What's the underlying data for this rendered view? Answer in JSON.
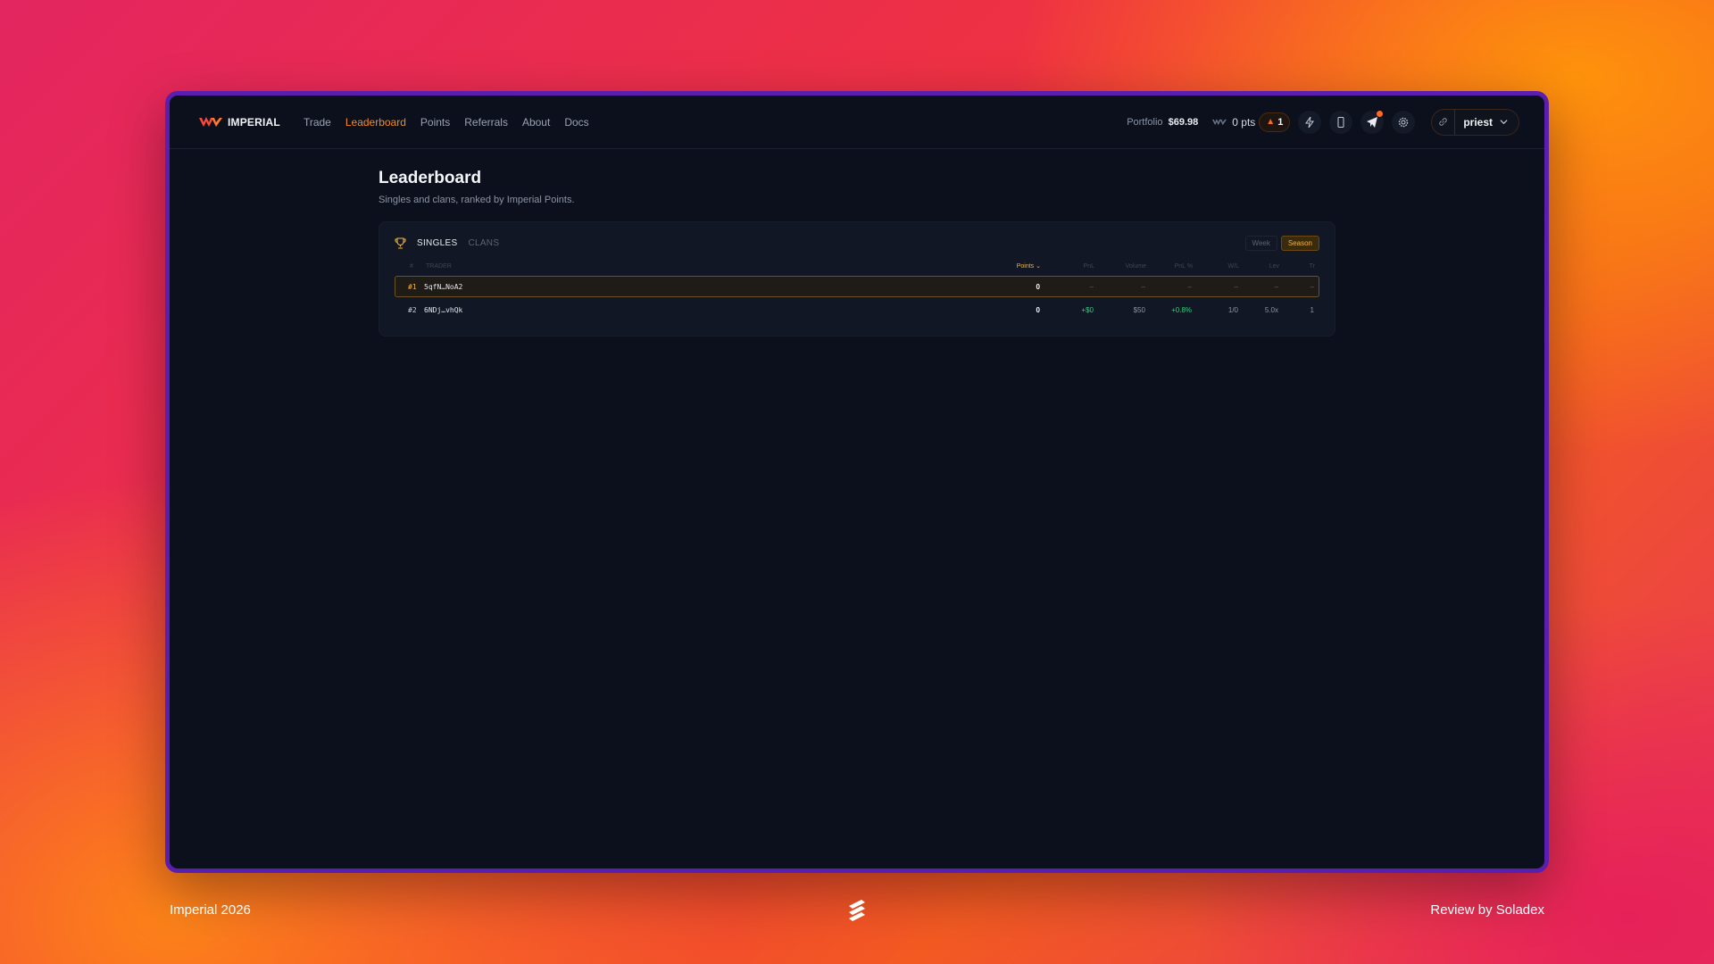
{
  "app": {
    "brand": "IMPERIAL",
    "nav": [
      {
        "label": "Trade",
        "active": false
      },
      {
        "label": "Leaderboard",
        "active": true
      },
      {
        "label": "Points",
        "active": false
      },
      {
        "label": "Referrals",
        "active": false
      },
      {
        "label": "About",
        "active": false
      },
      {
        "label": "Docs",
        "active": false
      }
    ],
    "portfolio_label": "Portfolio",
    "portfolio_value": "$69.98",
    "points": "0 pts",
    "streak": "1",
    "icons": [
      "bolt-icon",
      "phone-icon",
      "send-icon",
      "gear-icon"
    ],
    "user": "priest",
    "accent": "#f58a1f"
  },
  "page": {
    "title": "Leaderboard",
    "subtitle": "Singles and clans, ranked by Imperial Points."
  },
  "leaderboard": {
    "tabs": [
      "SINGLES",
      "CLANS"
    ],
    "active_tab": "SINGLES",
    "periods": [
      "Week",
      "Season"
    ],
    "active_period": "Season",
    "columns": [
      "#",
      "TRADER",
      "Points",
      "PnL",
      "Volume",
      "PnL %",
      "W/L",
      "Lev",
      "Tr"
    ],
    "rows": [
      {
        "rank": "#1",
        "trader": "5qfN…NoA2",
        "points": "0",
        "pnl": "–",
        "volume": "–",
        "pnl_pct": "–",
        "wl": "–",
        "lev": "–",
        "tr": "–"
      },
      {
        "rank": "#2",
        "trader": "6NDj…vhQk",
        "points": "0",
        "pnl": "+$0",
        "volume": "$50",
        "pnl_pct": "+0.8%",
        "wl": "1/0",
        "lev": "5.0x",
        "tr": "1"
      }
    ]
  },
  "footer": {
    "left": "Imperial 2026",
    "right": "Review by Soladex"
  }
}
